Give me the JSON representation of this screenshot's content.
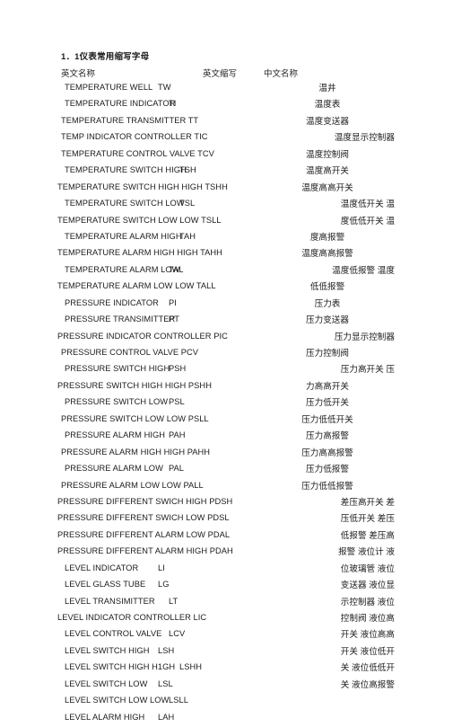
{
  "document": {
    "title": "1．1仪表常用缩写字母",
    "headers": {
      "english_name": "英文名称",
      "english_abbr": "英文缩写",
      "chinese_name": "中文名称"
    }
  },
  "rows": [
    {
      "english": "TEMPERATURE WELL",
      "abbr": "TW"
    },
    {
      "english": "TEMPERATURE INDICATOR",
      "abbr": "TI"
    },
    {
      "english": "TEMPERATURE TRANSMITTER TT",
      "abbr": ""
    },
    {
      "english": "TEMP INDICATOR CONTROLLER TIC",
      "abbr": ""
    },
    {
      "english": "TEMPERATURE CONTROL VALVE TCV",
      "abbr": ""
    },
    {
      "english": "TEMPERATURE SWITCH HIGH",
      "abbr": "TSH"
    },
    {
      "english": "TEMPERATURE SWITCH HIGH HIGH TSHH",
      "abbr": ""
    },
    {
      "english": "TEMPERATURE SWITCH LOW",
      "abbr": "TSL"
    },
    {
      "english": "TEMPERATURE SWITCH LOW LOW TSLL",
      "abbr": ""
    },
    {
      "english": "TEMPERATURE ALARM HIGH",
      "abbr": "TAH"
    },
    {
      "english": "TEMPERATURE ALARM HIGH HIGH TAHH",
      "abbr": ""
    },
    {
      "english": "TEMPERATURE ALARM LOW",
      "abbr": "TAL"
    },
    {
      "english": "TEMPERATURE ALARM LOW LOW TALL",
      "abbr": ""
    },
    {
      "english": "PRESSURE INDICATOR",
      "abbr": "PI"
    },
    {
      "english": "PRESSURE TRANSIMITTER",
      "abbr": "PT"
    },
    {
      "english": "PRESSURE INDICATOR CONTROLLER PIC",
      "abbr": ""
    },
    {
      "english": "PRESSURE CONTROL VALVE PCV",
      "abbr": ""
    },
    {
      "english": "PRESSURE SWITCH HIGH",
      "abbr": "PSH"
    },
    {
      "english": "PRESSURE SWITCH HIGH HIGH PSHH",
      "abbr": ""
    },
    {
      "english": "PRESSURE SWITCH LOW",
      "abbr": "PSL"
    },
    {
      "english": "PRESSURE SWITCH LOW LOW PSLL",
      "abbr": ""
    },
    {
      "english": "PRESSURE ALARM HIGH",
      "abbr": "PAH"
    },
    {
      "english": "PRESSURE ALARM HIGH HIGH PAHH",
      "abbr": ""
    },
    {
      "english": "PRESSURE ALARM LOW",
      "abbr": "PAL"
    },
    {
      "english": "PRESSURE ALARM LOW LOW PALL",
      "abbr": ""
    },
    {
      "english": "PRESSURE DIFFERENT SWICH HIGH PDSH",
      "abbr": ""
    },
    {
      "english": "PRESSURE DIFFERENT SWICH LOW PDSL",
      "abbr": ""
    },
    {
      "english": "PRESSURE DIFFERENT ALARM LOW PDAL",
      "abbr": ""
    },
    {
      "english": "PRESSURE DIFFERENT ALARM HIGH PDAH",
      "abbr": ""
    },
    {
      "english": "LEVEL INDICATOR",
      "abbr": "LI"
    },
    {
      "english": "LEVEL GLASS TUBE",
      "abbr": "LG"
    },
    {
      "english": "LEVEL TRANSIMITTER",
      "abbr": "LT"
    },
    {
      "english": "LEVEL INDICATOR CONTROLLER LIC",
      "abbr": ""
    },
    {
      "english": "LEVEL CONTROL VALVE",
      "abbr": "LCV"
    },
    {
      "english": "LEVEL SWITCH HIGH",
      "abbr": "LSH"
    },
    {
      "english": "LEVEL SWITCH HIGH H1GH",
      "abbr": "LSHH"
    },
    {
      "english": "LEVEL SWITCH LOW",
      "abbr": "LSL"
    },
    {
      "english": "LEVEL SWITCH LOW LOW",
      "abbr": "LSLL"
    },
    {
      "english": "LEVEL ALARM HIGH",
      "abbr": "LAH"
    }
  ],
  "chinese_lines": [
    "温井",
    "温度表",
    "温度变送器",
    "温度显示控制器",
    "温度控制阀",
    "温度高开关",
    "温度高高开关",
    "温度低开关 温",
    "度低低开关 温",
    "度高报警",
    "温度高高报警",
    "温度低报警 温度",
    "低低报警",
    "压力表",
    "压力变送器",
    "压力显示控制器",
    "压力控制阀",
    "压力高开关 压",
    "力高高开关",
    "压力低开关",
    "压力低低开关",
    "压力高报警",
    "压力高高报警",
    "压力低报警",
    "压力低低报警",
    "差压高开关 差",
    "压低开关 差压",
    "低报警 差压高",
    "报警 液位计 液",
    "位玻璃管 液位",
    "变送器 液位显",
    "示控制器 液位",
    "控制阀 液位高",
    "开关 液位高高",
    "开关 液位低开",
    "关 液位低低开",
    "关 液位高报警",
    "",
    ""
  ]
}
